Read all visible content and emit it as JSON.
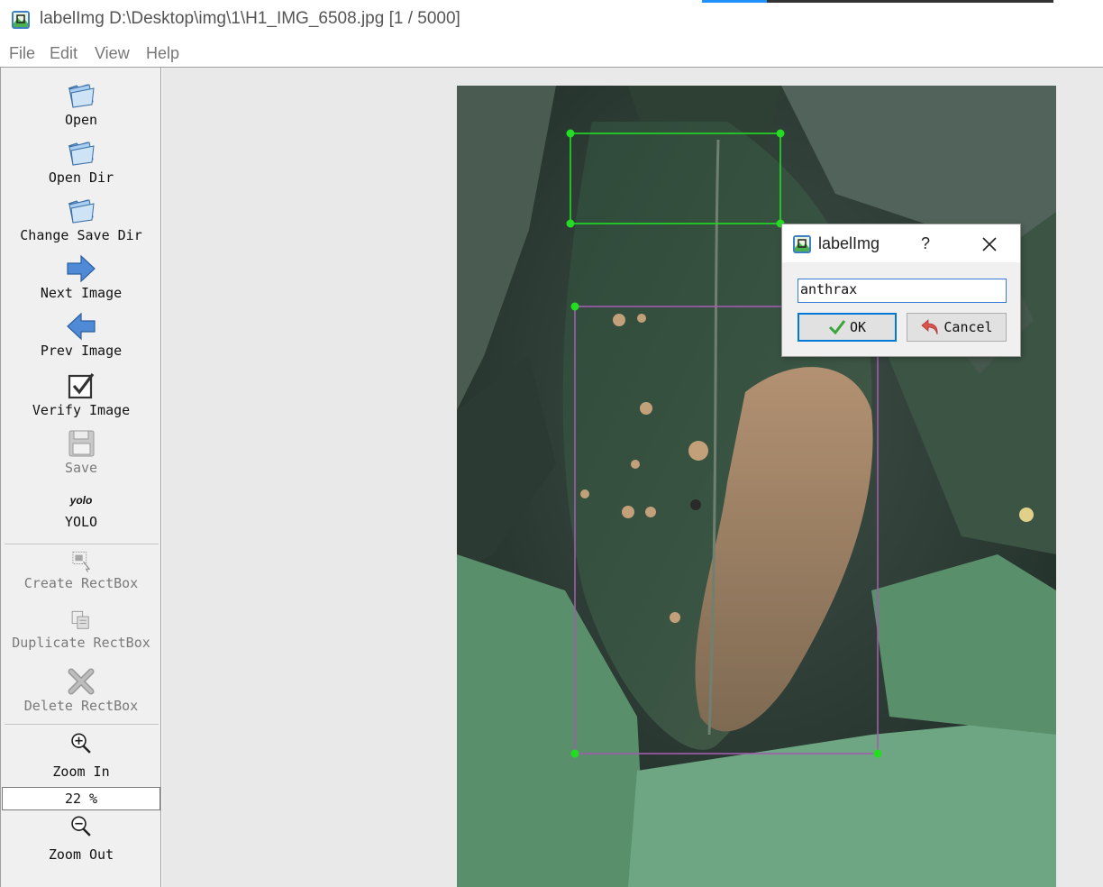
{
  "window": {
    "title": "labelImg D:\\Desktop\\img\\1\\H1_IMG_6508.jpg [1 / 5000]",
    "icon": "labelimg-app-icon"
  },
  "menu": [
    "File",
    "Edit",
    "View",
    "Help"
  ],
  "toolbar": {
    "open": "Open",
    "open_dir": "Open Dir",
    "change_save_dir": "Change Save Dir",
    "next_image": "Next Image",
    "prev_image": "Prev Image",
    "verify_image": "Verify Image",
    "save": "Save",
    "format_icon_text": "yolo",
    "format": "YOLO",
    "create_rectbox": "Create RectBox",
    "duplicate_rectbox": "Duplicate RectBox",
    "delete_rectbox": "Delete RectBox",
    "zoom_in": "Zoom In",
    "zoom_value": "22 %",
    "zoom_out": "Zoom Out"
  },
  "colors": {
    "selected_box": "#22dd22",
    "unselected_box": "#a35bb0",
    "dialog_focus": "#0078d7"
  },
  "dialog": {
    "title": "labelImg",
    "help": "?",
    "input_value": "anthrax",
    "ok": "OK",
    "cancel": "Cancel"
  }
}
